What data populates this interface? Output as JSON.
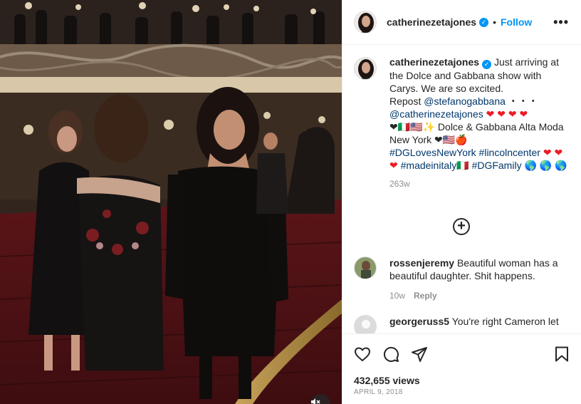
{
  "post": {
    "author": "catherinezetajones",
    "follow_label": "Follow",
    "more_label": "•••",
    "separator": "•",
    "verified_mark": "✓"
  },
  "caption": {
    "author": "catherinezetajones",
    "text_1": "Just arriving at the Dolce and Gabbana show with Carys. We are so excited.",
    "text_2": "Repost",
    "mention_1": "@stefanogabbana",
    "dots": "・・・",
    "mention_2": "@catherinezetajones",
    "hearts_1": "❤ ❤ ❤ ❤",
    "line_4_emoji": "❤🇮🇹🇺🇸✨",
    "text_3": "Dolce & Gabbana Alta Moda New York",
    "line_5_emoji": "❤🇺🇸🍎",
    "hashtag_1": "#DGLovesNewYork",
    "hashtag_2": "#lincolncenter",
    "hearts_2": "❤ ❤ ❤",
    "hashtag_3": "#madeinitaly",
    "flag_it": "🇮🇹",
    "hashtag_4": "#DGFamily",
    "globes": "🌎 🌎 🌎",
    "age": "263w"
  },
  "load_more_symbol": "+",
  "comments": [
    {
      "username": "rossenjeremy",
      "text": "Beautiful woman has a beautiful daughter. Shit happens.",
      "age": "10w",
      "reply_label": "Reply"
    },
    {
      "username": "georgeruss5",
      "text": "You're right Cameron let"
    }
  ],
  "footer": {
    "views": "432,655 views",
    "date": "APRIL 9, 2018"
  },
  "icons": {
    "like": "heart-icon",
    "comment": "comment-icon",
    "share": "share-icon",
    "save": "bookmark-icon",
    "mute": "muted-speaker-icon"
  },
  "colors": {
    "accent": "#0095f6",
    "text": "#262626",
    "secondary": "#8e8e8e",
    "link": "#00376b",
    "heart": "#ed1c24"
  }
}
